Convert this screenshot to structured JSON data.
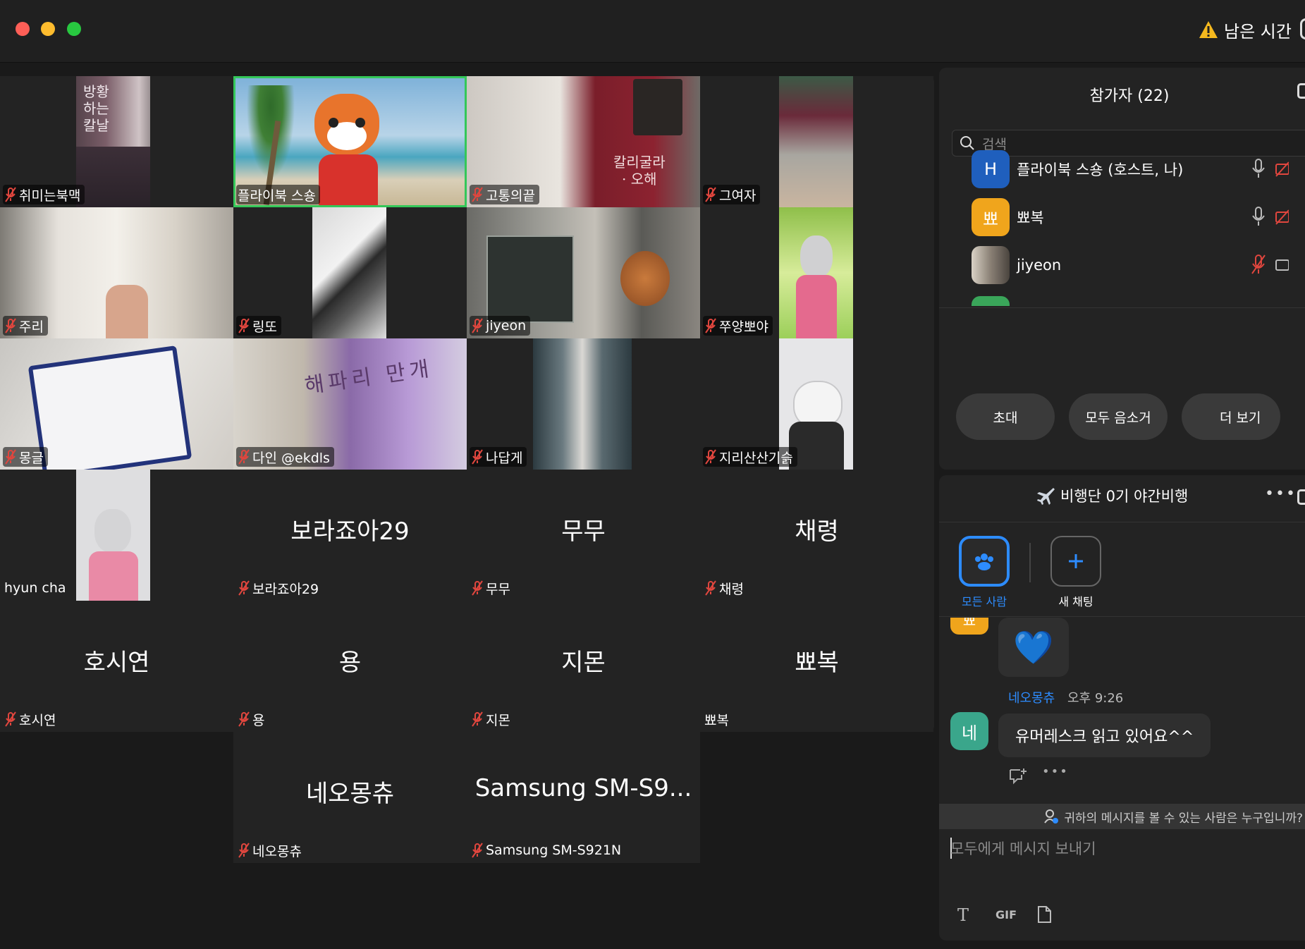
{
  "window": {
    "time_remaining_label": "남은 시간"
  },
  "gallery": {
    "tiles": [
      {
        "name": "취미는북맥",
        "muted": true
      },
      {
        "name": "플라이북 스숑",
        "muted": false,
        "active_speaker": true
      },
      {
        "name": "고통의끝",
        "muted": true
      },
      {
        "name": "그여자",
        "muted": true
      },
      {
        "name": "주리",
        "muted": true
      },
      {
        "name": "링또",
        "muted": true
      },
      {
        "name": "jiyeon",
        "muted": true
      },
      {
        "name": "쭈양뽀야",
        "muted": true
      },
      {
        "name": "몽글",
        "muted": true
      },
      {
        "name": "다인 @ekdls",
        "muted": true
      },
      {
        "name": "나답게",
        "muted": true
      },
      {
        "name": "지리산산기슭",
        "muted": true
      },
      {
        "name": "hyun cha",
        "muted": false
      },
      {
        "name": "보라죠아29",
        "display": "보라죠아29",
        "muted": true
      },
      {
        "name": "무무",
        "display": "무무",
        "muted": true
      },
      {
        "name": "채령",
        "display": "채령",
        "muted": true
      },
      {
        "name": "호시연",
        "display": "호시연",
        "muted": true
      },
      {
        "name": "용",
        "display": "용",
        "muted": true
      },
      {
        "name": "지몬",
        "display": "지몬",
        "muted": true
      },
      {
        "name": "뾰복",
        "display": "뾰복",
        "muted": false
      },
      {
        "name": "네오몽츄",
        "display": "네오몽츄",
        "muted": true
      },
      {
        "name": "Samsung SM-S921N",
        "display": "Samsung SM-S9...",
        "muted": true
      }
    ],
    "book_texts": {
      "t0": "방황\n하는\n칼날",
      "t2": "칼리굴라\n· 오해",
      "t9": "해파리 만개"
    }
  },
  "participants": {
    "title": "참가자 (22)",
    "search_placeholder": "검색",
    "rows": [
      {
        "initial": "H",
        "name": "플라이북 스숑 (호스트, 나)",
        "color": "#1f5fbd"
      },
      {
        "initial": "뾰",
        "name": "뾰복",
        "color": "#f0a51c"
      },
      {
        "initial": "",
        "name": "jiyeon",
        "color": "#6b6258"
      }
    ],
    "buttons": {
      "invite": "초대",
      "mute_all": "모두 음소거",
      "more": "더 보기"
    }
  },
  "chat": {
    "title": "비행단 0기 야간비행",
    "tab_everyone": "모든 사람",
    "tab_new_chat": "새 채팅",
    "partial_avatar_initial": "뾰",
    "emoji": "💙",
    "message_sender": "네오몽츄",
    "message_time": "오후 9:26",
    "message_avatar_initial": "네",
    "message_text": "유머레스크 읽고 있어요^^",
    "who_can_see": "귀하의 메시지를 볼 수 있는 사람은 누구입니까?",
    "input_placeholder": "모두에게 메시지 보내기",
    "gif_label": "GIF",
    "colors": {
      "accent": "#2d8cff",
      "chat_avatar": "#3aa68b",
      "active_speaker": "#34c759",
      "muted_icon": "#e0463e"
    }
  }
}
